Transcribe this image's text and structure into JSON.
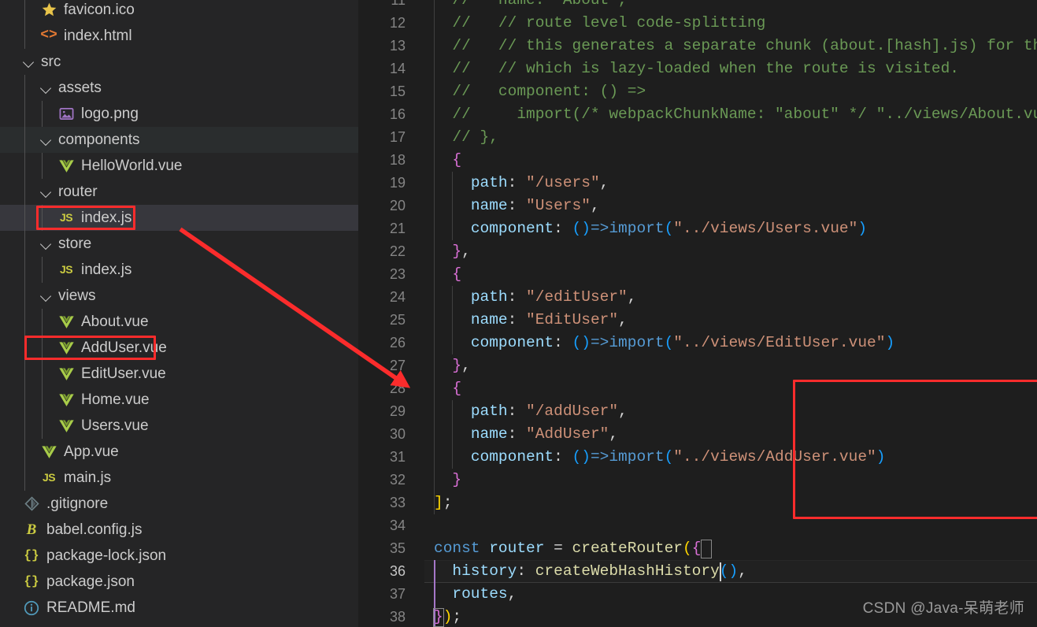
{
  "theme": {
    "sidebar_bg": "#252526",
    "editor_bg": "#1e1e1e",
    "row_hover": "#2a2d2e",
    "row_selected": "#37373d",
    "annotation_red": "#fb2c2c",
    "accent_comment": "#6a9955",
    "accent_string": "#ce9178",
    "accent_property": "#9cdcfe",
    "accent_function": "#dcdcaa",
    "accent_keyword": "#569cd6",
    "bracket_magenta": "#da70d6",
    "bracket_yellow": "#ffd700",
    "bracket_blue": "#179fff"
  },
  "explorer": {
    "items": [
      {
        "label": "favicon.ico",
        "icon": "star-icon",
        "glyph": "★",
        "icon_class": "ic-star",
        "depth": 1,
        "type": "file",
        "state": "normal"
      },
      {
        "label": "index.html",
        "icon": "html-icon",
        "glyph": "<>",
        "icon_class": "ic-html",
        "depth": 1,
        "type": "file",
        "state": "normal"
      },
      {
        "label": "src",
        "icon": "folder-icon",
        "glyph": "",
        "icon_class": "",
        "depth": 0,
        "type": "folder",
        "state": "normal"
      },
      {
        "label": "assets",
        "icon": "folder-icon",
        "glyph": "",
        "icon_class": "",
        "depth": 1,
        "type": "folder",
        "state": "normal"
      },
      {
        "label": "logo.png",
        "icon": "image-icon",
        "glyph": "ὛC",
        "icon_class": "ic-img",
        "depth": 2,
        "type": "file",
        "state": "normal"
      },
      {
        "label": "components",
        "icon": "folder-icon",
        "glyph": "",
        "icon_class": "",
        "depth": 1,
        "type": "folder",
        "state": "hovered"
      },
      {
        "label": "HelloWorld.vue",
        "icon": "vue-icon",
        "glyph": "V",
        "icon_class": "ic-vue",
        "depth": 2,
        "type": "file",
        "state": "normal"
      },
      {
        "label": "router",
        "icon": "folder-icon",
        "glyph": "",
        "icon_class": "",
        "depth": 1,
        "type": "folder",
        "state": "normal"
      },
      {
        "label": "index.js",
        "icon": "js-icon",
        "glyph": "JS",
        "icon_class": "ic-js",
        "depth": 2,
        "type": "file",
        "state": "selected"
      },
      {
        "label": "store",
        "icon": "folder-icon",
        "glyph": "",
        "icon_class": "",
        "depth": 1,
        "type": "folder",
        "state": "normal"
      },
      {
        "label": "index.js",
        "icon": "js-icon",
        "glyph": "JS",
        "icon_class": "ic-js",
        "depth": 2,
        "type": "file",
        "state": "normal"
      },
      {
        "label": "views",
        "icon": "folder-icon",
        "glyph": "",
        "icon_class": "",
        "depth": 1,
        "type": "folder",
        "state": "normal"
      },
      {
        "label": "About.vue",
        "icon": "vue-icon",
        "glyph": "V",
        "icon_class": "ic-vue",
        "depth": 2,
        "type": "file",
        "state": "normal"
      },
      {
        "label": "AddUser.vue",
        "icon": "vue-icon",
        "glyph": "V",
        "icon_class": "ic-vue",
        "depth": 2,
        "type": "file",
        "state": "normal"
      },
      {
        "label": "EditUser.vue",
        "icon": "vue-icon",
        "glyph": "V",
        "icon_class": "ic-vue",
        "depth": 2,
        "type": "file",
        "state": "normal"
      },
      {
        "label": "Home.vue",
        "icon": "vue-icon",
        "glyph": "V",
        "icon_class": "ic-vue",
        "depth": 2,
        "type": "file",
        "state": "normal"
      },
      {
        "label": "Users.vue",
        "icon": "vue-icon",
        "glyph": "V",
        "icon_class": "ic-vue",
        "depth": 2,
        "type": "file",
        "state": "normal"
      },
      {
        "label": "App.vue",
        "icon": "vue-icon",
        "glyph": "V",
        "icon_class": "ic-vue",
        "depth": 1,
        "type": "file",
        "state": "normal"
      },
      {
        "label": "main.js",
        "icon": "js-icon",
        "glyph": "JS",
        "icon_class": "ic-js",
        "depth": 1,
        "type": "file",
        "state": "normal"
      },
      {
        "label": ".gitignore",
        "icon": "git-icon",
        "glyph": "◈",
        "icon_class": "ic-git",
        "depth": 0,
        "type": "file",
        "state": "normal"
      },
      {
        "label": "babel.config.js",
        "icon": "babel-icon",
        "glyph": "B",
        "icon_class": "ic-babel",
        "depth": 0,
        "type": "file",
        "state": "normal"
      },
      {
        "label": "package-lock.json",
        "icon": "json-icon",
        "glyph": "{}",
        "icon_class": "ic-json",
        "depth": 0,
        "type": "file",
        "state": "normal"
      },
      {
        "label": "package.json",
        "icon": "json-icon",
        "glyph": "{}",
        "icon_class": "ic-json",
        "depth": 0,
        "type": "file",
        "state": "normal"
      },
      {
        "label": "README.md",
        "icon": "info-icon",
        "glyph": "ⓘ",
        "icon_class": "ic-md",
        "depth": 0,
        "type": "file",
        "state": "normal"
      }
    ]
  },
  "annotations": {
    "file_boxes": [
      {
        "target": "index.js",
        "label": "router-index-js-highlight"
      },
      {
        "target": "AddUser.vue",
        "label": "adduser-vue-highlight"
      }
    ],
    "code_box": {
      "first_line": 28,
      "last_line": 33,
      "label": "addUser-route-highlight"
    },
    "arrow": {
      "from": "AddUser.vue in explorer",
      "to": "line 28 in editor",
      "color": "#fb2c2c"
    }
  },
  "editor": {
    "first_visible_line": 11,
    "active_line": 36,
    "lines": [
      {
        "n": 11,
        "tokens": [
          {
            "t": "  //   name: \"About\",",
            "c": "t-comment"
          }
        ]
      },
      {
        "n": 12,
        "tokens": [
          {
            "t": "  //   // route level code-splitting",
            "c": "t-comment"
          }
        ]
      },
      {
        "n": 13,
        "tokens": [
          {
            "t": "  //   // this generates a separate chunk (about.[hash].js) for th",
            "c": "t-comment"
          }
        ]
      },
      {
        "n": 14,
        "tokens": [
          {
            "t": "  //   // which is lazy-loaded when the route is visited.",
            "c": "t-comment"
          }
        ]
      },
      {
        "n": 15,
        "tokens": [
          {
            "t": "  //   component: () =>",
            "c": "t-comment"
          }
        ]
      },
      {
        "n": 16,
        "tokens": [
          {
            "t": "  //     import(/* webpackChunkName: \"about\" */ \"../views/About.vu",
            "c": "t-comment"
          }
        ]
      },
      {
        "n": 17,
        "tokens": [
          {
            "t": "  // },",
            "c": "t-comment"
          }
        ]
      },
      {
        "n": 18,
        "tokens": [
          {
            "t": "  ",
            "c": "t-plain"
          },
          {
            "t": "{",
            "c": "t-b1"
          }
        ]
      },
      {
        "n": 19,
        "tokens": [
          {
            "t": "    ",
            "c": "t-plain"
          },
          {
            "t": "path",
            "c": "t-prop"
          },
          {
            "t": ": ",
            "c": "t-plain"
          },
          {
            "t": "\"/users\"",
            "c": "t-str"
          },
          {
            "t": ",",
            "c": "t-plain"
          }
        ]
      },
      {
        "n": 20,
        "tokens": [
          {
            "t": "    ",
            "c": "t-plain"
          },
          {
            "t": "name",
            "c": "t-prop"
          },
          {
            "t": ": ",
            "c": "t-plain"
          },
          {
            "t": "\"Users\"",
            "c": "t-str"
          },
          {
            "t": ",",
            "c": "t-plain"
          }
        ]
      },
      {
        "n": 21,
        "tokens": [
          {
            "t": "    ",
            "c": "t-plain"
          },
          {
            "t": "component",
            "c": "t-prop"
          },
          {
            "t": ": ",
            "c": "t-plain"
          },
          {
            "t": "()",
            "c": "t-b3"
          },
          {
            "t": "=>",
            "c": "t-kw"
          },
          {
            "t": "import",
            "c": "t-kw"
          },
          {
            "t": "(",
            "c": "t-b3"
          },
          {
            "t": "\"../views/Users.vue\"",
            "c": "t-str"
          },
          {
            "t": ")",
            "c": "t-b3"
          }
        ]
      },
      {
        "n": 22,
        "tokens": [
          {
            "t": "  ",
            "c": "t-plain"
          },
          {
            "t": "}",
            "c": "t-b1"
          },
          {
            "t": ",",
            "c": "t-plain"
          }
        ]
      },
      {
        "n": 23,
        "tokens": [
          {
            "t": "  ",
            "c": "t-plain"
          },
          {
            "t": "{",
            "c": "t-b1"
          }
        ]
      },
      {
        "n": 24,
        "tokens": [
          {
            "t": "    ",
            "c": "t-plain"
          },
          {
            "t": "path",
            "c": "t-prop"
          },
          {
            "t": ": ",
            "c": "t-plain"
          },
          {
            "t": "\"/editUser\"",
            "c": "t-str"
          },
          {
            "t": ",",
            "c": "t-plain"
          }
        ]
      },
      {
        "n": 25,
        "tokens": [
          {
            "t": "    ",
            "c": "t-plain"
          },
          {
            "t": "name",
            "c": "t-prop"
          },
          {
            "t": ": ",
            "c": "t-plain"
          },
          {
            "t": "\"EditUser\"",
            "c": "t-str"
          },
          {
            "t": ",",
            "c": "t-plain"
          }
        ]
      },
      {
        "n": 26,
        "tokens": [
          {
            "t": "    ",
            "c": "t-plain"
          },
          {
            "t": "component",
            "c": "t-prop"
          },
          {
            "t": ": ",
            "c": "t-plain"
          },
          {
            "t": "()",
            "c": "t-b3"
          },
          {
            "t": "=>",
            "c": "t-kw"
          },
          {
            "t": "import",
            "c": "t-kw"
          },
          {
            "t": "(",
            "c": "t-b3"
          },
          {
            "t": "\"../views/EditUser.vue\"",
            "c": "t-str"
          },
          {
            "t": ")",
            "c": "t-b3"
          }
        ]
      },
      {
        "n": 27,
        "tokens": [
          {
            "t": "  ",
            "c": "t-plain"
          },
          {
            "t": "}",
            "c": "t-b1"
          },
          {
            "t": ",",
            "c": "t-plain"
          }
        ]
      },
      {
        "n": 28,
        "tokens": [
          {
            "t": "  ",
            "c": "t-plain"
          },
          {
            "t": "{",
            "c": "t-b1"
          }
        ]
      },
      {
        "n": 29,
        "tokens": [
          {
            "t": "    ",
            "c": "t-plain"
          },
          {
            "t": "path",
            "c": "t-prop"
          },
          {
            "t": ": ",
            "c": "t-plain"
          },
          {
            "t": "\"/addUser\"",
            "c": "t-str"
          },
          {
            "t": ",",
            "c": "t-plain"
          }
        ]
      },
      {
        "n": 30,
        "tokens": [
          {
            "t": "    ",
            "c": "t-plain"
          },
          {
            "t": "name",
            "c": "t-prop"
          },
          {
            "t": ": ",
            "c": "t-plain"
          },
          {
            "t": "\"AddUser\"",
            "c": "t-str"
          },
          {
            "t": ",",
            "c": "t-plain"
          }
        ]
      },
      {
        "n": 31,
        "tokens": [
          {
            "t": "    ",
            "c": "t-plain"
          },
          {
            "t": "component",
            "c": "t-prop"
          },
          {
            "t": ": ",
            "c": "t-plain"
          },
          {
            "t": "()",
            "c": "t-b3"
          },
          {
            "t": "=>",
            "c": "t-kw"
          },
          {
            "t": "import",
            "c": "t-kw"
          },
          {
            "t": "(",
            "c": "t-b3"
          },
          {
            "t": "\"../views/AddUser.vue\"",
            "c": "t-str"
          },
          {
            "t": ")",
            "c": "t-b3"
          }
        ]
      },
      {
        "n": 32,
        "tokens": [
          {
            "t": "  ",
            "c": "t-plain"
          },
          {
            "t": "}",
            "c": "t-b1"
          }
        ]
      },
      {
        "n": 33,
        "tokens": [
          {
            "t": "]",
            "c": "t-b2"
          },
          {
            "t": ";",
            "c": "t-plain"
          }
        ]
      },
      {
        "n": 34,
        "tokens": [
          {
            "t": "",
            "c": "t-plain"
          }
        ]
      },
      {
        "n": 35,
        "tokens": [
          {
            "t": "const",
            "c": "t-kw"
          },
          {
            "t": " ",
            "c": "t-plain"
          },
          {
            "t": "router",
            "c": "t-var"
          },
          {
            "t": " = ",
            "c": "t-plain"
          },
          {
            "t": "createRouter",
            "c": "t-fn"
          },
          {
            "t": "(",
            "c": "t-b2"
          },
          {
            "t": "{",
            "c": "t-b1"
          }
        ]
      },
      {
        "n": 36,
        "tokens": [
          {
            "t": "  ",
            "c": "t-plain"
          },
          {
            "t": "history",
            "c": "t-prop"
          },
          {
            "t": ": ",
            "c": "t-plain"
          },
          {
            "t": "createWebHashHistory",
            "c": "t-fn"
          },
          {
            "t": "(",
            "c": "t-b3"
          },
          {
            "t": ")",
            "c": "t-b3"
          },
          {
            "t": ",",
            "c": "t-plain"
          }
        ]
      },
      {
        "n": 37,
        "tokens": [
          {
            "t": "  ",
            "c": "t-plain"
          },
          {
            "t": "routes",
            "c": "t-prop"
          },
          {
            "t": ",",
            "c": "t-plain"
          }
        ]
      },
      {
        "n": 38,
        "tokens": [
          {
            "t": "}",
            "c": "t-b1"
          },
          {
            "t": ")",
            "c": "t-b2"
          },
          {
            "t": ";",
            "c": "t-plain"
          }
        ]
      }
    ]
  },
  "watermark": {
    "text": "CSDN @Java-呆萌老师"
  }
}
